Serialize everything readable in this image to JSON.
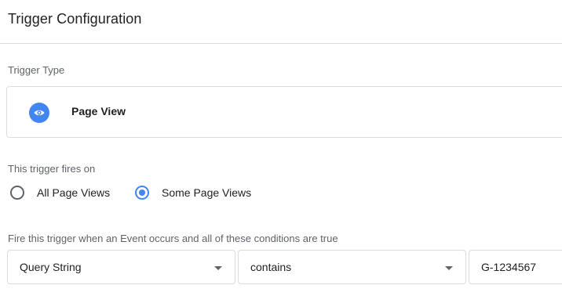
{
  "header": {
    "title": "Trigger Configuration"
  },
  "trigger_type": {
    "label": "Trigger Type",
    "selected": {
      "name": "Page View",
      "icon": "eye-icon",
      "icon_color": "#4285f4"
    }
  },
  "fires_on": {
    "label": "This trigger fires on",
    "options": [
      {
        "label": "All Page Views",
        "checked": false
      },
      {
        "label": "Some Page Views",
        "checked": true
      }
    ]
  },
  "conditions": {
    "label": "Fire this trigger when an Event occurs and all of these conditions are true",
    "variable": "Query String",
    "operator": "contains",
    "value": "G-1234567"
  },
  "colors": {
    "accent": "#4285f4",
    "border": "#dadce0",
    "secondary_text": "#5f6368"
  }
}
